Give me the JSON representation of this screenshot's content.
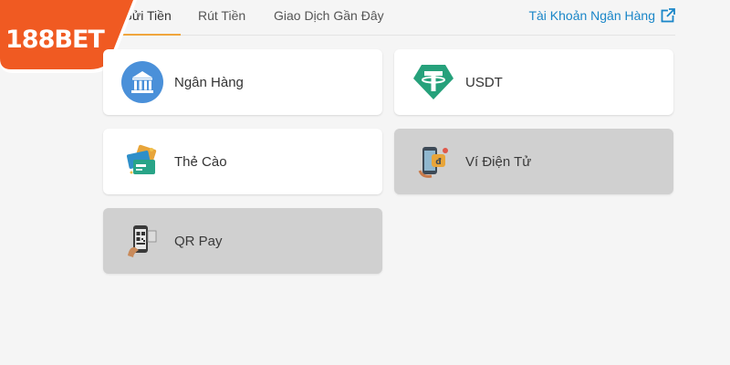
{
  "logo": {
    "text": "188BET",
    "color_bg": "#f05a22"
  },
  "tabs": [
    {
      "label": "Gửi Tiền",
      "active": true
    },
    {
      "label": "Rút Tiền",
      "active": false
    },
    {
      "label": "Giao Dịch Gần Đây",
      "active": false
    }
  ],
  "bank_account_link": {
    "label": "Tài Khoản Ngân Hàng",
    "icon": "external-link-icon"
  },
  "methods": [
    {
      "label": "Ngân Hàng",
      "icon": "bank-icon",
      "enabled": true
    },
    {
      "label": "USDT",
      "icon": "tether-icon",
      "enabled": true
    },
    {
      "label": "Thẻ Cào",
      "icon": "scratch-card-icon",
      "enabled": true
    },
    {
      "label": "Ví Điện Tử",
      "icon": "e-wallet-icon",
      "enabled": false
    },
    {
      "label": "QR Pay",
      "icon": "qr-pay-icon",
      "enabled": false
    }
  ],
  "colors": {
    "accent": "#f0a53c",
    "link": "#1a86c8",
    "tether": "#26a17b",
    "bank": "#4a90d9"
  }
}
